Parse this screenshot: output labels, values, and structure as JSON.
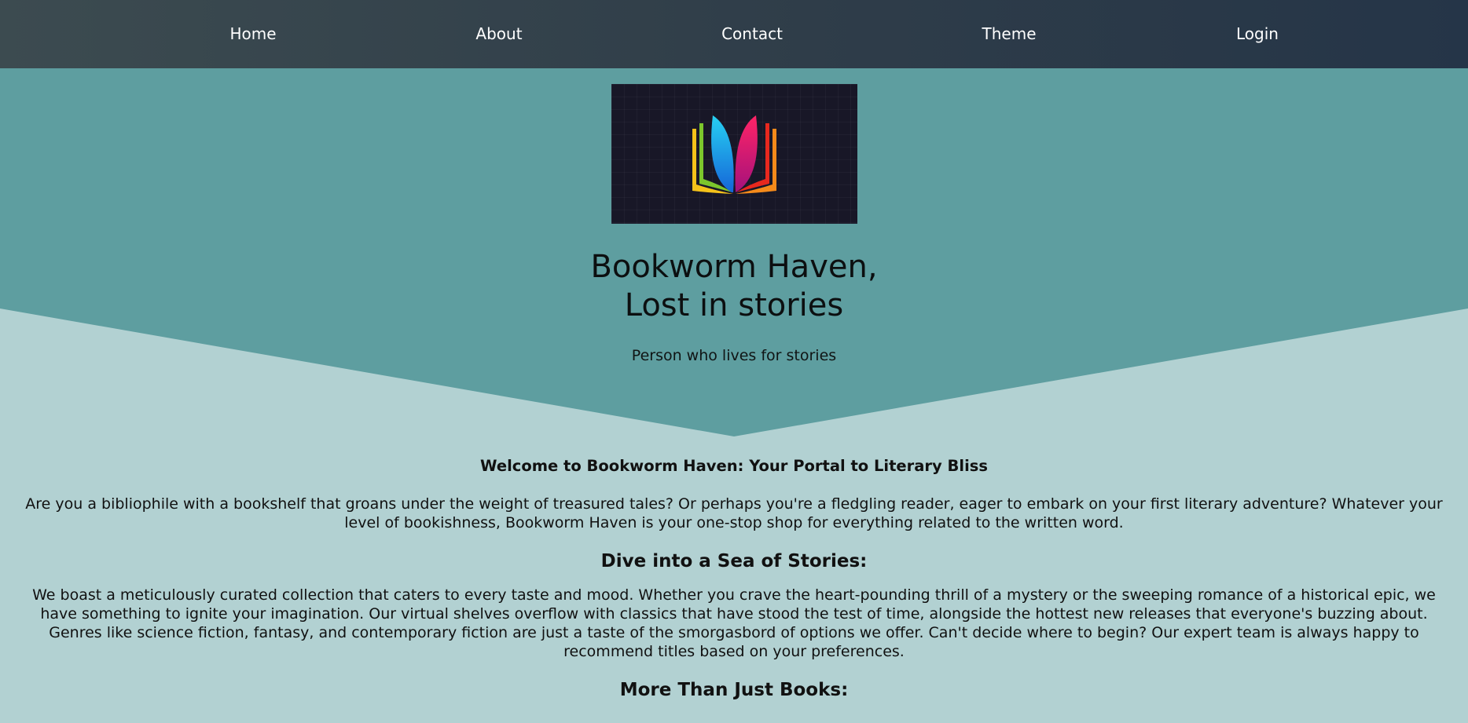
{
  "nav": {
    "items": [
      {
        "label": "Home"
      },
      {
        "label": "About"
      },
      {
        "label": "Contact"
      },
      {
        "label": "Theme"
      },
      {
        "label": "Login"
      }
    ]
  },
  "hero": {
    "title_line1": "Bookworm Haven,",
    "title_line2": "Lost in stories",
    "subtitle": "Person who lives for stories",
    "logo_icon": "open-book-icon"
  },
  "content": {
    "welcome_heading": "Welcome to Bookworm Haven: Your Portal to Literary Bliss",
    "intro_lines": [
      "Are you a bibliophile with a bookshelf that groans under the weight of treasured tales? Or perhaps you're a fledgling reader, eager to embark on your first literary adventure? Whatever your",
      "level of bookishness, Bookworm Haven is your one-stop shop for everything related to the written word."
    ],
    "section1_heading": "Dive into a Sea of Stories:",
    "section1_lines": [
      "We boast a meticulously curated collection that caters to every taste and mood. Whether you crave the heart-pounding thrill of a mystery or the sweeping romance of a historical epic, we",
      "have something to ignite your imagination. Our virtual shelves overflow with classics that have stood the test of time, alongside the hottest new releases that everyone's buzzing about.",
      "Genres like science fiction, fantasy, and contemporary fiction are just a taste of the smorgasbord of options we offer. Can't decide where to begin? Our expert team is always happy to",
      "recommend titles based on your preferences."
    ],
    "section2_heading": "More Than Just Books:"
  },
  "colors": {
    "nav_gradient_start": "#3c4b50",
    "nav_gradient_end": "#253548",
    "hero_teal": "#5e9ea0",
    "page_background": "#b2d1d2",
    "logo_background": "#181727"
  }
}
